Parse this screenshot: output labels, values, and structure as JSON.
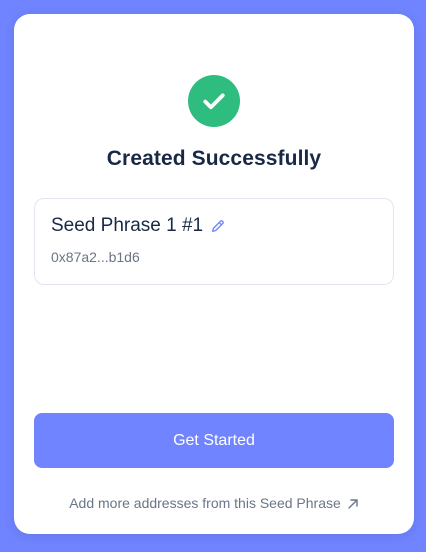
{
  "header": {
    "title": "Created Successfully"
  },
  "account": {
    "name": "Seed Phrase 1 #1",
    "address": "0x87a2...b1d6"
  },
  "actions": {
    "primary_label": "Get Started",
    "secondary_label": "Add more addresses from this Seed Phrase"
  },
  "icons": {
    "success": "check-circle-icon",
    "edit": "pencil-icon",
    "link": "arrow-up-right-icon"
  },
  "colors": {
    "background": "#7084ff",
    "accent": "#7084ff",
    "success": "#2ebd7f",
    "text_primary": "#192945",
    "text_secondary": "#6a7587"
  }
}
